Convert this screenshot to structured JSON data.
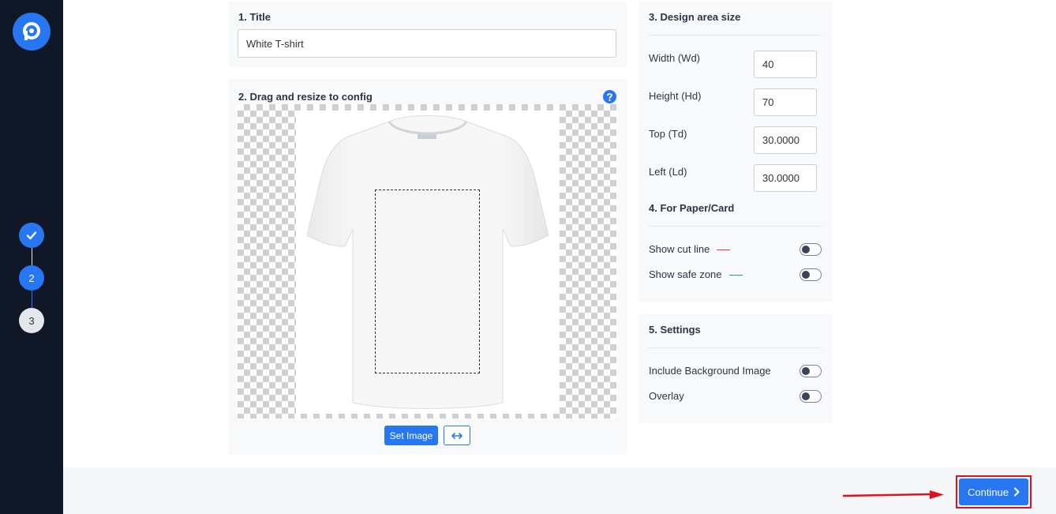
{
  "sidebar": {
    "logo_icon": "app-logo-icon",
    "steps": [
      {
        "state": "done",
        "icon": "check-icon"
      },
      {
        "label": "2",
        "state": "active"
      },
      {
        "label": "3",
        "state": "todo"
      }
    ]
  },
  "title_section": {
    "heading": "1. Title",
    "value": "White T-shirt"
  },
  "drag_section": {
    "heading": "2. Drag and resize to config",
    "help_icon": "help-icon",
    "set_image_label": "Set Image",
    "swap_icon": "swap-horizontal-icon"
  },
  "design_area": {
    "heading": "3. Design area size",
    "fields": [
      {
        "label": "Width (Wd)",
        "value": "40"
      },
      {
        "label": "Height (Hd)",
        "value": "70"
      },
      {
        "label": "Top (Td)",
        "value": "30.0000"
      },
      {
        "label": "Left (Ld)",
        "value": "30.0000"
      }
    ]
  },
  "paper_card": {
    "heading": "4. For Paper/Card",
    "cut_line_label": "Show cut line",
    "safe_zone_label": "Show safe zone",
    "cut_line_color": "#e0354a",
    "safe_zone_color": "#1f9c7a"
  },
  "settings": {
    "heading": "5. Settings",
    "include_bg_label": "Include Background Image",
    "overlay_label": "Overlay"
  },
  "footer": {
    "continue_label": "Continue",
    "continue_icon": "chevron-right-icon"
  },
  "colors": {
    "accent": "#2677f1",
    "sidebar_bg": "#101828",
    "highlight": "#e0111c"
  }
}
